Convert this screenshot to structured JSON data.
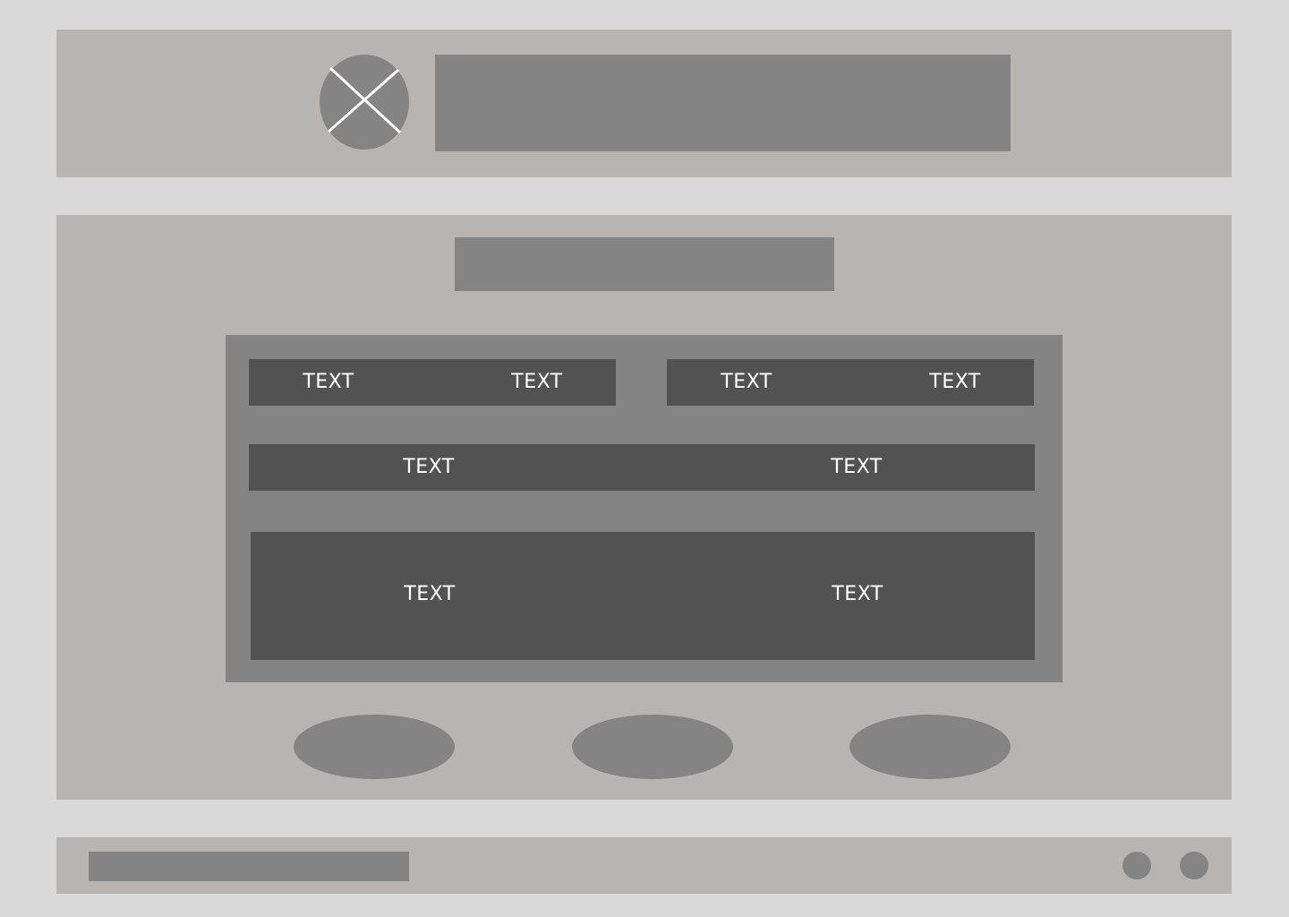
{
  "colors": {
    "background": "#d9d9d9",
    "panel": "#b6b5b3",
    "placeholder": "#848484",
    "dark_row": "#525252",
    "text": "#ffffff"
  },
  "header": {
    "logo_icon": "image-placeholder-icon"
  },
  "content": {
    "rows": [
      {
        "left_pair": [
          "TEXT",
          "TEXT"
        ],
        "right_pair": [
          "TEXT",
          "TEXT"
        ]
      },
      {
        "cells": [
          "TEXT",
          "TEXT"
        ]
      },
      {
        "cells": [
          "TEXT",
          "TEXT"
        ]
      }
    ]
  },
  "footer": {
    "icons": [
      "circle-icon",
      "circle-icon"
    ]
  }
}
